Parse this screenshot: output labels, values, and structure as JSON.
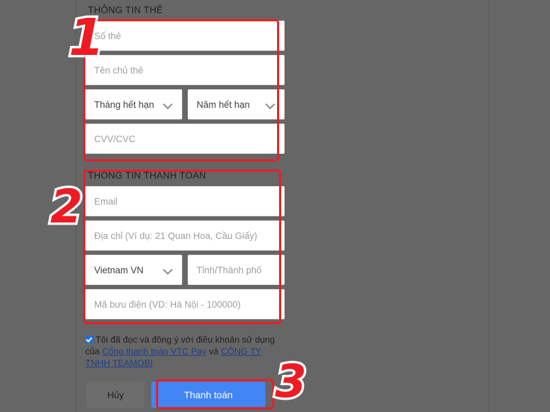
{
  "card_section": {
    "title": "THÔNG TIN THẺ",
    "card_number_placeholder": "Số thẻ",
    "card_holder_placeholder": "Tên chủ thẻ",
    "exp_month_label": "Tháng hết hạn",
    "exp_year_label": "Năm hết hạn",
    "cvv_placeholder": "CVV/CVC"
  },
  "billing_section": {
    "title": "THÔNG TIN THANH TOÁN",
    "email_placeholder": "Email",
    "address_placeholder": "Địa chỉ (Ví dụ: 21 Quan Hoa, Cầu Giấy)",
    "country_value": "Vietnam VN",
    "city_placeholder": "Tỉnh/Thành phố",
    "postcode_placeholder": "Mã bưu điện (VD: Hà Nội - 100000)"
  },
  "terms": {
    "text_before": "Tôi đã đọc và đồng ý với điều khoản sử dụng của ",
    "link1": "Cổng thanh toán VTC Pay",
    "text_middle": " và ",
    "link2": "CÔNG TY TNHH TEAMOBI",
    "checked": true
  },
  "actions": {
    "cancel_label": "Hủy",
    "pay_label": "Thanh toán"
  },
  "annotations": {
    "step1": "1",
    "step2": "2",
    "step3": "3",
    "accent_color": "#ec1c24",
    "outline_color": "#ffffff"
  },
  "colors": {
    "background": "#666666",
    "field_background": "#ffffff",
    "primary_button": "#4285f4",
    "link": "#1d3f87",
    "checkbox": "#1a73e8"
  }
}
